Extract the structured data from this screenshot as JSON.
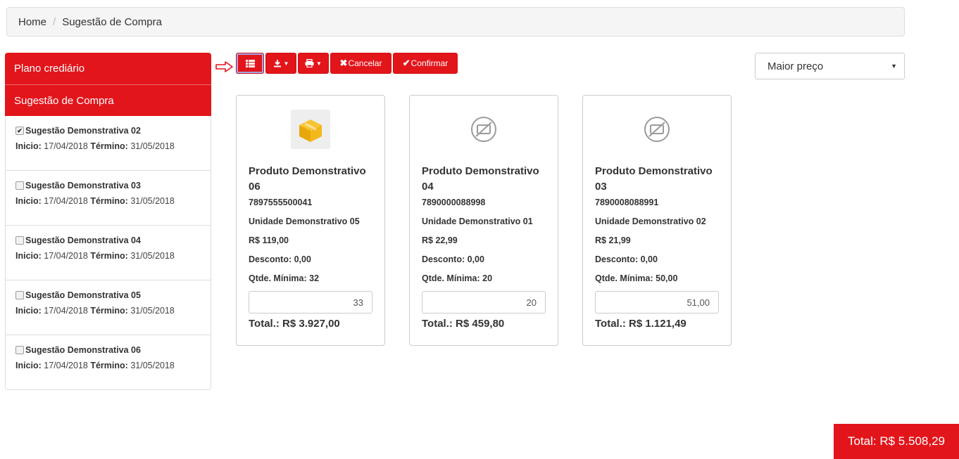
{
  "breadcrumb": {
    "home": "Home",
    "separator": "/",
    "current": "Sugestão de Compra"
  },
  "sidebar": {
    "header_plano": "Plano crediário",
    "header_sugestao": "Sugestão de Compra",
    "items": [
      {
        "title": "Sugestão Demonstrativa 02",
        "checked": true,
        "inicio_label": "Inicio:",
        "inicio": "17/04/2018",
        "termino_label": "Término:",
        "termino": "31/05/2018"
      },
      {
        "title": "Sugestão Demonstrativa 03",
        "checked": false,
        "inicio_label": "Inicio:",
        "inicio": "17/04/2018",
        "termino_label": "Término:",
        "termino": "31/05/2018"
      },
      {
        "title": "Sugestão Demonstrativa 04",
        "checked": false,
        "inicio_label": "Inicio:",
        "inicio": "17/04/2018",
        "termino_label": "Término:",
        "termino": "31/05/2018"
      },
      {
        "title": "Sugestão Demonstrativa 05",
        "checked": false,
        "inicio_label": "Inicio:",
        "inicio": "17/04/2018",
        "termino_label": "Término:",
        "termino": "31/05/2018"
      },
      {
        "title": "Sugestão Demonstrativa 06",
        "checked": false,
        "inicio_label": "Inicio:",
        "inicio": "17/04/2018",
        "termino_label": "Término:",
        "termino": "31/05/2018"
      }
    ]
  },
  "toolbar": {
    "list_icon": "list-icon",
    "download_icon": "download-icon",
    "print_icon": "print-icon",
    "cancel_label": "Cancelar",
    "confirm_label": "Confirmar"
  },
  "sort": {
    "selected": "Maior preço"
  },
  "products": [
    {
      "name": "Produto Demonstrativo 06",
      "code": "7897555500041",
      "unit": "Unidade Demonstrativo 05",
      "price": "R$ 119,00",
      "discount": "Desconto: 0,00",
      "min_qty": "Qtde. Mínima: 32",
      "qty": "33",
      "total": "Total.: R$ 3.927,00",
      "image": "product-box"
    },
    {
      "name": "Produto Demonstrativo 04",
      "code": "7890000088998",
      "unit": "Unidade Demonstrativo 01",
      "price": "R$ 22,99",
      "discount": "Desconto: 0,00",
      "min_qty": "Qtde. Mínima: 20",
      "qty": "20",
      "total": "Total.: R$ 459,80",
      "image": "no-image"
    },
    {
      "name": "Produto Demonstrativo 03",
      "code": "7890008088991",
      "unit": "Unidade Demonstrativo 02",
      "price": "R$ 21,99",
      "discount": "Desconto: 0,00",
      "min_qty": "Qtde. Mínima: 50,00",
      "qty": "51,00",
      "total": "Total.: R$ 1.121,49",
      "image": "no-image"
    }
  ],
  "grand_total": "Total: R$ 5.508,29",
  "colors": {
    "accent": "#e2151b",
    "border": "#cccccc"
  }
}
